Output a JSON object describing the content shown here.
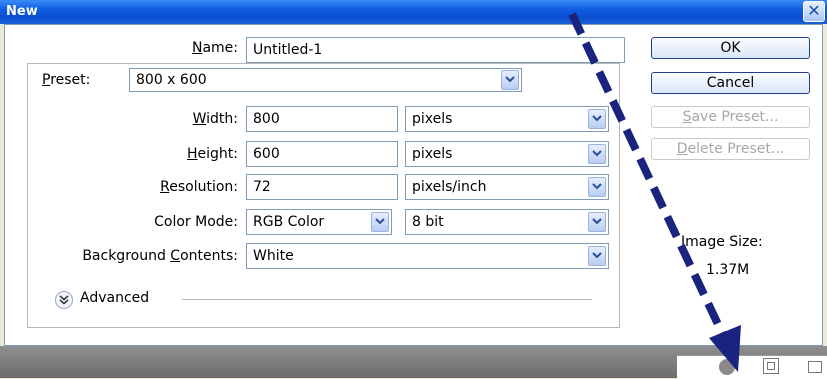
{
  "window": {
    "title": "New",
    "close_glyph": "✕"
  },
  "form": {
    "name": {
      "label_u": "N",
      "label_rest": "ame:",
      "value": "Untitled-1"
    },
    "preset": {
      "label_u": "P",
      "label_rest": "reset:",
      "value": "800 x 600"
    },
    "width": {
      "label_u": "W",
      "label_rest": "idth:",
      "value": "800",
      "unit": "pixels"
    },
    "height": {
      "label_u": "H",
      "label_rest": "eight:",
      "value": "600",
      "unit": "pixels"
    },
    "resolution": {
      "label_u": "R",
      "label_rest": "esolution:",
      "value": "72",
      "unit": "pixels/inch"
    },
    "color_mode": {
      "label": "Color Mode:",
      "value": "RGB Color",
      "depth": "8 bit"
    },
    "background": {
      "label_pre": "Background ",
      "label_u": "C",
      "label_rest": "ontents:",
      "value": "White"
    },
    "advanced": {
      "label": "Advanced",
      "icon": "expand-chevrons-icon"
    }
  },
  "buttons": {
    "ok": "OK",
    "cancel": "Cancel",
    "save_preset_u": "S",
    "save_preset_rest": "ave Preset...",
    "delete_preset_u": "D",
    "delete_preset_rest": "elete Preset..."
  },
  "image_size": {
    "label": "Image Size:",
    "value": "1.37M"
  },
  "colors": {
    "titlebar": "#0a4fd0",
    "arrow": "#1a237e",
    "accent_border": "#1f3f8e"
  }
}
